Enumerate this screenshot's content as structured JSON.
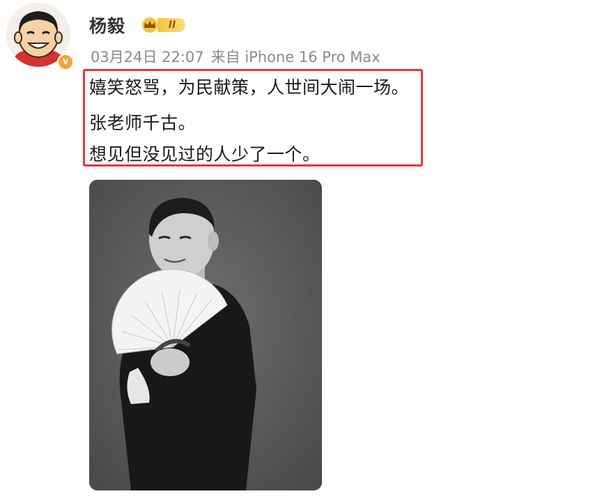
{
  "post": {
    "author": {
      "name": "杨毅",
      "avatar_icon": "cartoon-avatar-icon",
      "verified_icon": "verified-v-icon",
      "verified_mark": "v",
      "level_badge": {
        "icon": "crown-icon",
        "label": "II"
      }
    },
    "meta": {
      "date": "03月24日 22:07",
      "source": "来自 iPhone 16 Pro Max"
    },
    "content": {
      "lines": [
        "嬉笑怒骂，为民献策，人世间大闹一场。",
        "张老师千古。",
        "想见但没见过的人少了一个。"
      ],
      "highlight_color": "#e8343d"
    },
    "image": {
      "icon": "portrait-photo",
      "style": "black-and-white"
    }
  }
}
